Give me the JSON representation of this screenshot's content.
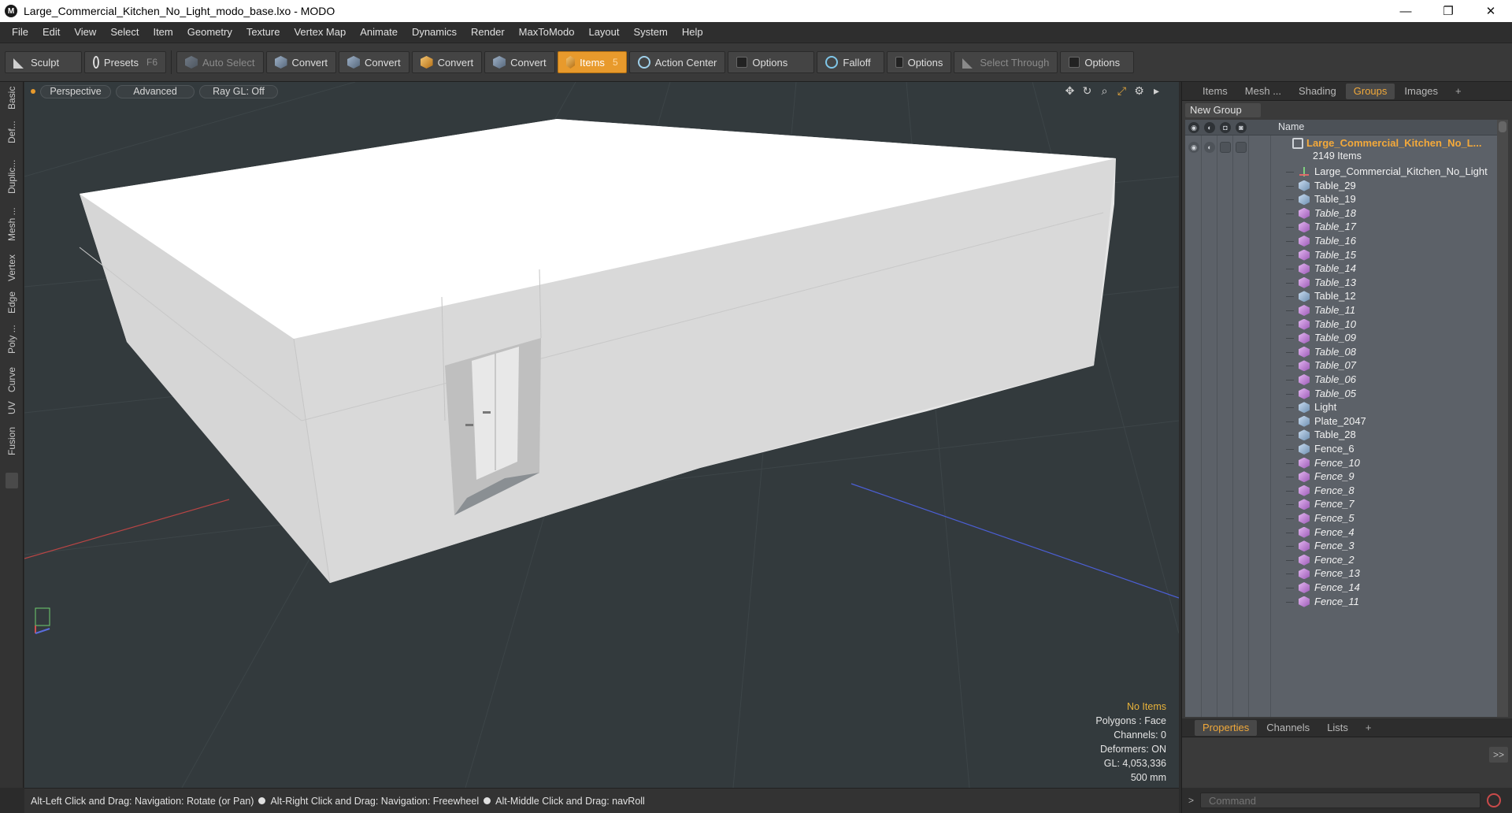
{
  "window": {
    "title": "Large_Commercial_Kitchen_No_Light_modo_base.lxo - MODO",
    "app_icon": "modo-logo",
    "controls": [
      "minimize-icon",
      "restore-icon",
      "close-icon"
    ],
    "minimize_glyph": "—",
    "restore_glyph": "❐",
    "close_glyph": "✕"
  },
  "menubar": {
    "items": [
      "File",
      "Edit",
      "View",
      "Select",
      "Item",
      "Geometry",
      "Texture",
      "Vertex Map",
      "Animate",
      "Dynamics",
      "Render",
      "MaxToModo",
      "Layout",
      "System",
      "Help"
    ]
  },
  "toolbar": {
    "sculpt": "Sculpt",
    "presets": "Presets",
    "presets_hotkey": "F6",
    "auto_select": "Auto Select",
    "convert": "Convert",
    "items": "Items",
    "items_hotkey": "5",
    "action_center": "Action Center",
    "options": "Options",
    "falloff": "Falloff",
    "select_through": "Select Through"
  },
  "left_tabs": [
    "Basic",
    "Def...",
    "Duplic...",
    "Mesh ...",
    "Vertex",
    "Edge",
    "Poly ...",
    "Curve",
    "UV",
    "Fusion"
  ],
  "viewport": {
    "view_mode": "Perspective",
    "shading": "Advanced",
    "raygl": "Ray GL: Off",
    "info": {
      "selection": "No Items",
      "polygons": "Polygons : Face",
      "channels": "Channels: 0",
      "deformers": "Deformers: ON",
      "gl": "GL: 4,053,336",
      "grid": "500 mm"
    },
    "colors": {
      "background": "#333a3d",
      "x_axis": "#c04040",
      "z_axis": "#4c5fd6",
      "model_top": "#ffffff",
      "model_side": "#d9d9d9"
    }
  },
  "right_panel": {
    "tabs": [
      "Items",
      "Mesh ...",
      "Shading",
      "Groups",
      "Images"
    ],
    "active_tab": "Groups",
    "new_group": "New Group",
    "name_column": "Name",
    "group": {
      "name": "Large_Commercial_Kitchen_No_L...",
      "count": "2149 Items"
    },
    "rows": [
      {
        "label": "Large_Commercial_Kitchen_No_Light",
        "icon": "locator",
        "italic": false
      },
      {
        "label": "Table_29",
        "icon": "blue",
        "italic": false
      },
      {
        "label": "Table_19",
        "icon": "blue",
        "italic": false
      },
      {
        "label": "Table_18",
        "icon": "purple",
        "italic": true
      },
      {
        "label": "Table_17",
        "icon": "purple",
        "italic": true
      },
      {
        "label": "Table_16",
        "icon": "purple",
        "italic": true
      },
      {
        "label": "Table_15",
        "icon": "purple",
        "italic": true
      },
      {
        "label": "Table_14",
        "icon": "purple",
        "italic": true
      },
      {
        "label": "Table_13",
        "icon": "purple",
        "italic": true
      },
      {
        "label": "Table_12",
        "icon": "blue",
        "italic": false
      },
      {
        "label": "Table_11",
        "icon": "purple",
        "italic": true
      },
      {
        "label": "Table_10",
        "icon": "purple",
        "italic": true
      },
      {
        "label": "Table_09",
        "icon": "purple",
        "italic": true
      },
      {
        "label": "Table_08",
        "icon": "purple",
        "italic": true
      },
      {
        "label": "Table_07",
        "icon": "purple",
        "italic": true
      },
      {
        "label": "Table_06",
        "icon": "purple",
        "italic": true
      },
      {
        "label": "Table_05",
        "icon": "purple",
        "italic": true
      },
      {
        "label": "Light",
        "icon": "blue",
        "italic": false
      },
      {
        "label": "Plate_2047",
        "icon": "blue",
        "italic": false
      },
      {
        "label": "Table_28",
        "icon": "blue",
        "italic": false
      },
      {
        "label": "Fence_6",
        "icon": "blue",
        "italic": false
      },
      {
        "label": "Fence_10",
        "icon": "purple",
        "italic": true
      },
      {
        "label": "Fence_9",
        "icon": "purple",
        "italic": true
      },
      {
        "label": "Fence_8",
        "icon": "purple",
        "italic": true
      },
      {
        "label": "Fence_7",
        "icon": "purple",
        "italic": true
      },
      {
        "label": "Fence_5",
        "icon": "purple",
        "italic": true
      },
      {
        "label": "Fence_4",
        "icon": "purple",
        "italic": true
      },
      {
        "label": "Fence_3",
        "icon": "purple",
        "italic": true
      },
      {
        "label": "Fence_2",
        "icon": "purple",
        "italic": true
      },
      {
        "label": "Fence_13",
        "icon": "purple",
        "italic": true
      },
      {
        "label": "Fence_14",
        "icon": "purple",
        "italic": true
      },
      {
        "label": "Fence_11",
        "icon": "purple",
        "italic": true
      }
    ],
    "bottom_tabs": [
      "Properties",
      "Channels",
      "Lists"
    ],
    "active_bottom_tab": "Properties",
    "expander": ">>",
    "command_placeholder": "Command",
    "command_prompt": ">"
  },
  "statusbar": {
    "hint1": "Alt-Left Click and Drag: Navigation: Rotate (or Pan)",
    "hint2": "Alt-Right Click and Drag: Navigation: Freewheel",
    "hint3": "Alt-Middle Click and Drag: navRoll"
  }
}
